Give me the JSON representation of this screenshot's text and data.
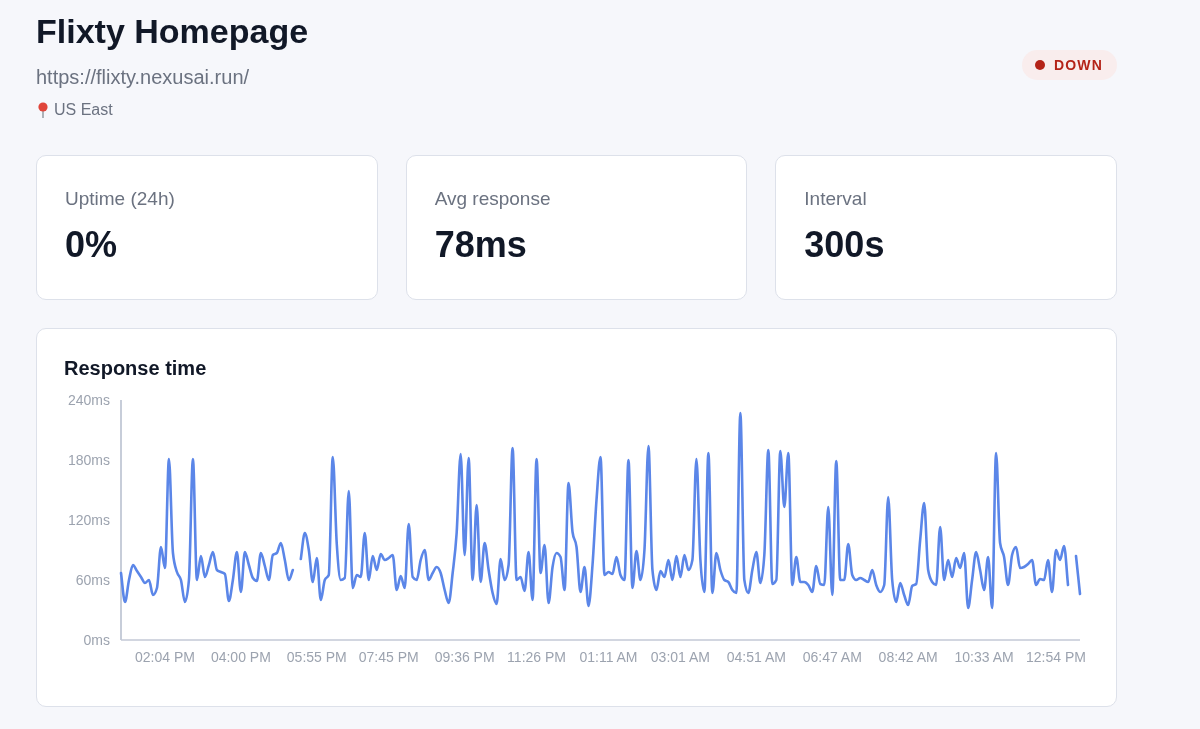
{
  "monitor": {
    "title": "Flixty Homepage",
    "url": "https://flixty.nexusai.run/",
    "region": "US East",
    "status": {
      "label": "DOWN",
      "color": "#b42318"
    }
  },
  "stats": [
    {
      "label": "Uptime (24h)",
      "value": "0%"
    },
    {
      "label": "Avg response",
      "value": "78ms"
    },
    {
      "label": "Interval",
      "value": "300s"
    }
  ],
  "response_chart": {
    "chart_data": {
      "type": "line",
      "title": "Response time",
      "categories": [
        null,
        null,
        null,
        null,
        null,
        null,
        null,
        null,
        null,
        null,
        null,
        "02:04 PM",
        null,
        null,
        null,
        null,
        null,
        null,
        null,
        null,
        null,
        null,
        null,
        null,
        null,
        null,
        null,
        null,
        null,
        null,
        "04:00 PM",
        null,
        null,
        null,
        null,
        null,
        null,
        null,
        null,
        null,
        null,
        null,
        null,
        null,
        null,
        null,
        null,
        null,
        null,
        "05:55 PM",
        null,
        null,
        null,
        null,
        null,
        null,
        null,
        null,
        null,
        null,
        null,
        null,
        null,
        null,
        null,
        null,
        null,
        "07:45 PM",
        null,
        null,
        null,
        null,
        null,
        null,
        null,
        null,
        null,
        null,
        null,
        null,
        null,
        null,
        null,
        null,
        null,
        null,
        "09:36 PM",
        null,
        null,
        null,
        null,
        null,
        null,
        null,
        null,
        null,
        null,
        null,
        null,
        null,
        null,
        null,
        null,
        null,
        "11:26 PM",
        null,
        null,
        null,
        null,
        null,
        null,
        null,
        null,
        null,
        null,
        null,
        null,
        null,
        null,
        null,
        null,
        null,
        "01:11 AM",
        null,
        null,
        null,
        null,
        null,
        null,
        null,
        null,
        null,
        null,
        null,
        null,
        null,
        null,
        null,
        null,
        null,
        "03:01 AM",
        null,
        null,
        null,
        null,
        null,
        null,
        null,
        null,
        null,
        null,
        null,
        null,
        null,
        null,
        null,
        null,
        null,
        null,
        "04:51 AM",
        null,
        null,
        null,
        null,
        null,
        null,
        null,
        null,
        null,
        null,
        null,
        null,
        null,
        null,
        null,
        null,
        null,
        null,
        "06:47 AM",
        null,
        null,
        null,
        null,
        null,
        null,
        null,
        null,
        null,
        null,
        null,
        null,
        null,
        null,
        null,
        null,
        null,
        null,
        "08:42 AM",
        null,
        null,
        null,
        null,
        null,
        null,
        null,
        null,
        null,
        null,
        null,
        null,
        null,
        null,
        null,
        null,
        null,
        null,
        "10:33 AM",
        null,
        null,
        null,
        null,
        null,
        null,
        null,
        null,
        null,
        null,
        null,
        null,
        null,
        null,
        null,
        null,
        null,
        "12:54 PM",
        null,
        null,
        null,
        null,
        null,
        null
      ],
      "series": [
        {
          "color": "#5b86e8",
          "values": [
            67,
            38,
            60,
            75,
            69,
            63,
            57,
            60,
            45,
            52,
            93,
            72,
            181,
            87,
            68,
            60,
            38,
            60,
            181,
            60,
            84,
            63,
            75,
            88,
            70,
            68,
            66,
            39,
            60,
            88,
            48,
            88,
            75,
            62,
            59,
            87,
            74,
            60,
            85,
            87,
            97,
            80,
            60,
            70,
            null,
            81,
            107,
            90,
            58,
            82,
            40,
            60,
            65,
            183,
            96,
            60,
            62,
            149,
            52,
            65,
            63,
            107,
            60,
            84,
            70,
            86,
            80,
            82,
            85,
            50,
            64,
            52,
            116,
            63,
            60,
            80,
            90,
            60,
            67,
            73,
            67,
            50,
            37,
            67,
            107,
            186,
            85,
            182,
            60,
            135,
            58,
            97,
            70,
            47,
            36,
            81,
            60,
            75,
            192,
            60,
            63,
            49,
            88,
            40,
            181,
            67,
            95,
            37,
            73,
            87,
            83,
            50,
            157,
            108,
            93,
            48,
            73,
            34,
            75,
            140,
            183,
            65,
            68,
            66,
            83,
            65,
            60,
            180,
            52,
            89,
            60,
            90,
            194,
            70,
            50,
            69,
            63,
            80,
            60,
            84,
            63,
            85,
            70,
            80,
            181,
            80,
            48,
            187,
            47,
            87,
            70,
            60,
            58,
            50,
            47,
            227,
            60,
            47,
            70,
            88,
            57,
            85,
            190,
            56,
            60,
            189,
            133,
            187,
            55,
            83,
            58,
            58,
            55,
            48,
            74,
            56,
            55,
            133,
            45,
            179,
            60,
            60,
            96,
            65,
            60,
            62,
            60,
            58,
            70,
            55,
            48,
            55,
            143,
            60,
            38,
            57,
            45,
            35,
            54,
            56,
            100,
            137,
            70,
            58,
            55,
            113,
            60,
            80,
            63,
            82,
            72,
            87,
            32,
            60,
            88,
            70,
            50,
            83,
            32,
            187,
            97,
            83,
            55,
            85,
            93,
            72,
            73,
            76,
            80,
            55,
            61,
            60,
            80,
            48,
            90,
            80,
            94,
            55,
            null,
            84,
            46
          ]
        }
      ],
      "ylim": [
        0,
        240
      ],
      "yticks": [
        {
          "value": 0,
          "label": "0ms"
        },
        {
          "value": 60,
          "label": "60ms"
        },
        {
          "value": 120,
          "label": "120ms"
        },
        {
          "value": 180,
          "label": "180ms"
        },
        {
          "value": 240,
          "label": "240ms"
        }
      ]
    }
  }
}
